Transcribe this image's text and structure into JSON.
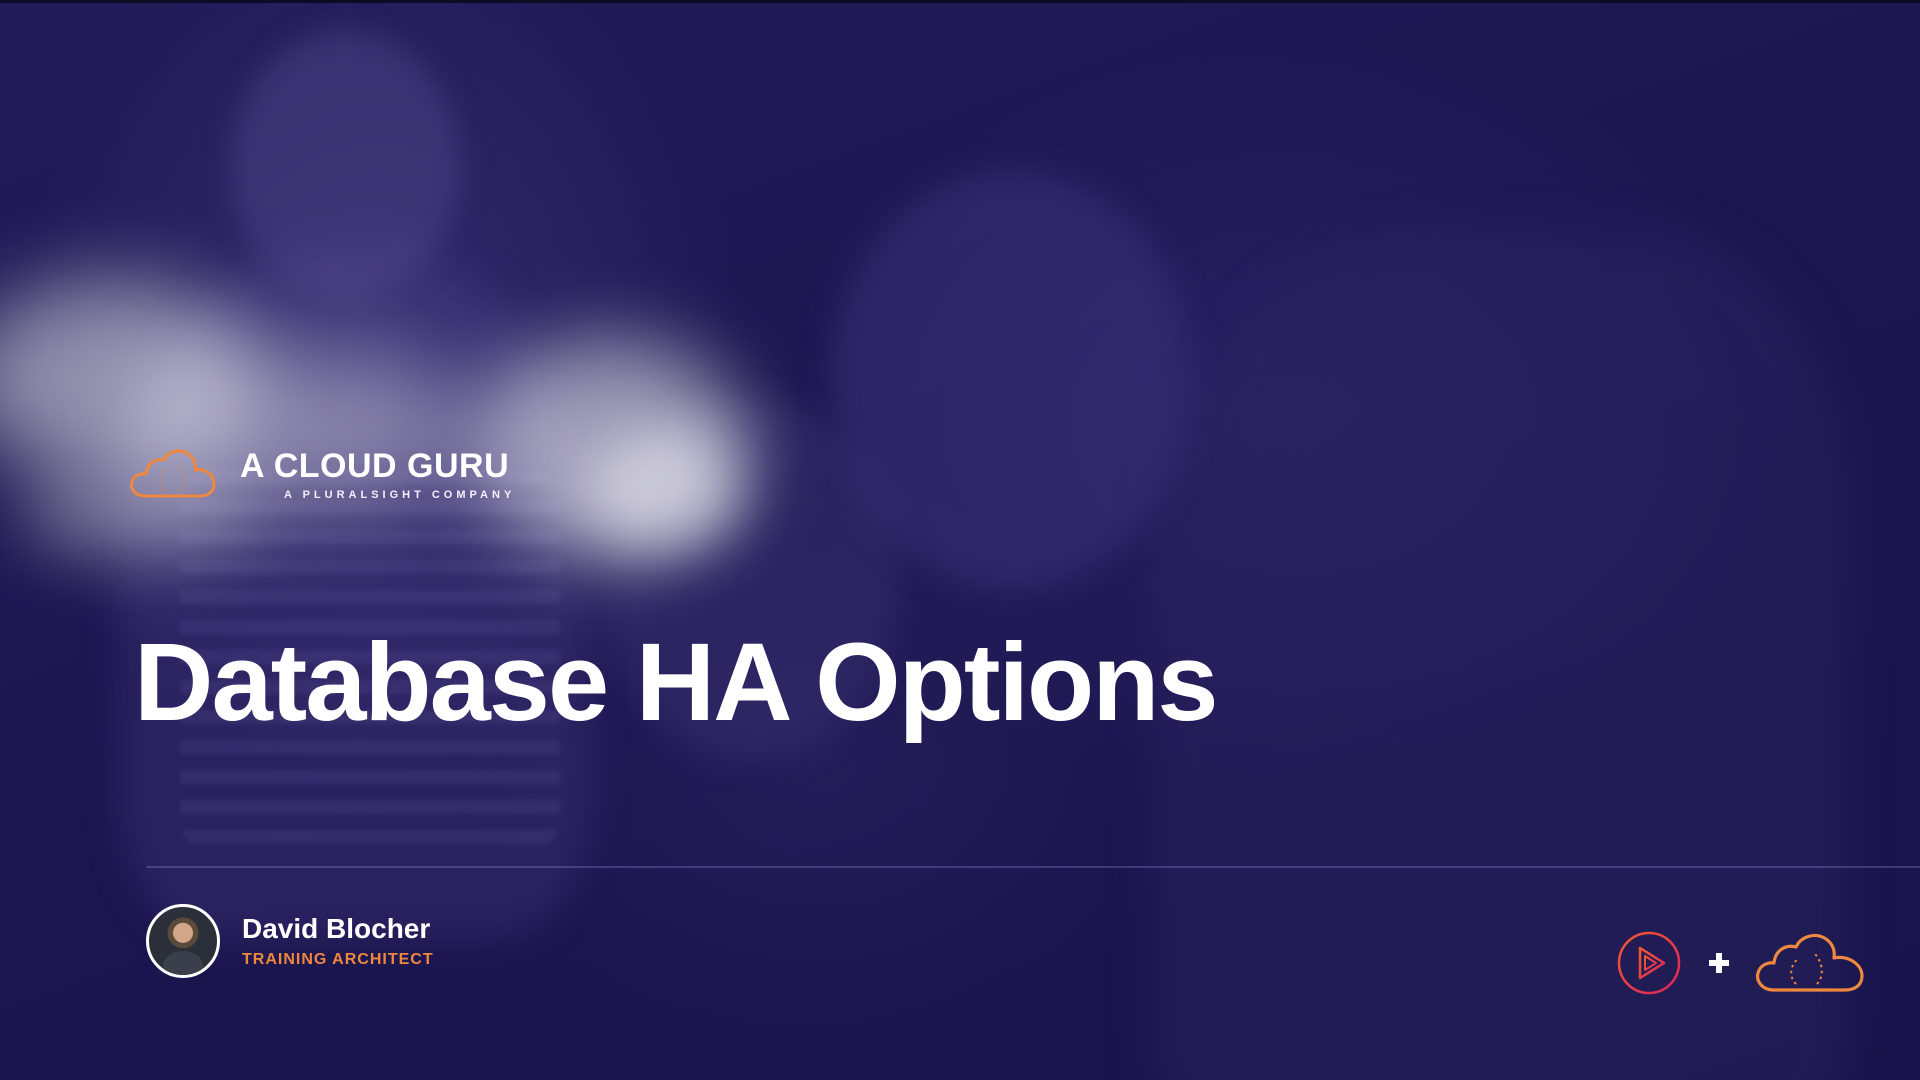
{
  "brand": {
    "name": "A CLOUD GURU",
    "subtitle": "A PLURALSIGHT COMPANY",
    "logo_icon": "cloud-logo-icon",
    "accent_color": "#f0873e"
  },
  "slide": {
    "title": "Database HA Options"
  },
  "presenter": {
    "name": "David Blocher",
    "role": "TRAINING ARCHITECT"
  },
  "footer_logos": {
    "icons": [
      "pluralsight-play-icon",
      "plus-icon",
      "acg-cloud-icon"
    ],
    "pluralsight_color": "#e0245e",
    "acg_color": "#f0873e"
  },
  "colors": {
    "background": "#1a1548",
    "text": "#ffffff"
  }
}
